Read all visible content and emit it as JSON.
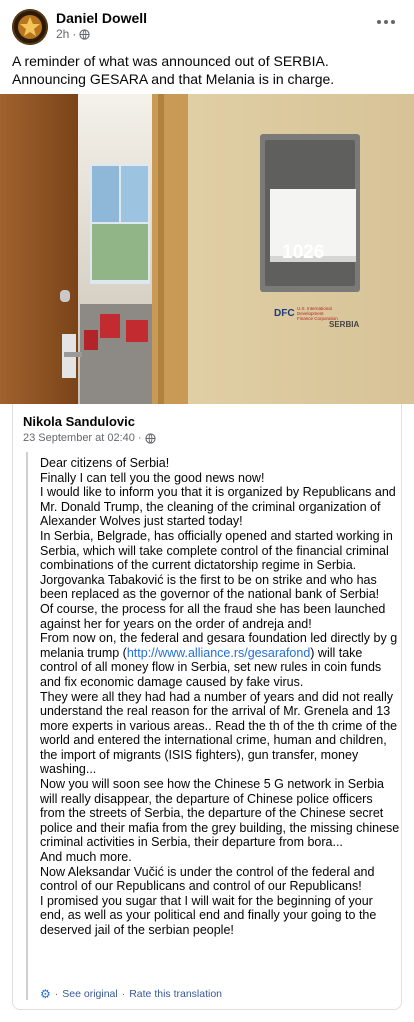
{
  "post": {
    "author": "Daniel Dowell",
    "time": "2h",
    "text_line1": "A reminder of what was announced out of SERBIA.",
    "text_line2": "Announcing GESARA and that Melania is in charge."
  },
  "photo": {
    "room_number": "1026",
    "sign_logo": "DFC",
    "sign_org_line1": "U.S. International",
    "sign_org_line2": "Development",
    "sign_org_line3": "Finance Corporation",
    "sign_country": "SERBIA"
  },
  "shared": {
    "author": "Nikola Sandulovic",
    "time": "23 September at 02:40",
    "separator": "·",
    "paragraphs": [
      "Dear citizens of Serbia!",
      "Finally I can tell you the good news now!",
      "I would like to inform you that it is organized by Republicans and Mr. Donald Trump, the cleaning of the criminal organization of Alexander Wolves just started today!",
      "In Serbia, Belgrade, has officially opened and started working in Serbia, which will take complete control of the financial criminal combinations of the current dictatorship regime in Serbia.",
      "Jorgovanka Tabaković is the first to be on strike and who has been replaced as the governor of the national bank of Serbia!",
      "Of course, the process for all the fraud she has been launched against her for years on the order of andreja and!"
    ],
    "para_link_before": "From now on, the federal and gesara foundation led directly by g melania trump (",
    "link_text": "http://www.alliance.rs/gesarafond",
    "para_link_after": ") will take control of all money flow in Serbia, set new rules in coin funds and fix economic damage caused by fake virus.",
    "paragraphs2": [
      "They were all they had had a number of years and did not really understand the real reason for the arrival of Mr. Grenela and 13 more experts in various areas.. Read the th of the th crime of the world and entered the international crime, human and children, the import of migrants (ISIS fighters), gun transfer, money washing...",
      "Now you will soon see how the Chinese 5 G network in Serbia will really disappear, the departure of Chinese police officers from the streets of Serbia, the departure of the Chinese secret police and their mafia from the grey building, the missing chinese criminal activities in Serbia, their departure from bora...",
      "And much more.",
      "Now Aleksandar Vučić is under the control of the federal and control of our Republicans and control of our Republicans!",
      "I promised you sugar that I will wait for the beginning of your end, as well as your political end and finally your going to the deserved jail of the serbian people!"
    ],
    "see_original": "See original",
    "rate_translation": "Rate this translation",
    "dot": "·"
  },
  "colors": {
    "link": "#216fdb",
    "muted": "#65676b",
    "text": "#050505"
  },
  "icons": [
    "globe-icon",
    "more-icon",
    "gear-icon"
  ]
}
